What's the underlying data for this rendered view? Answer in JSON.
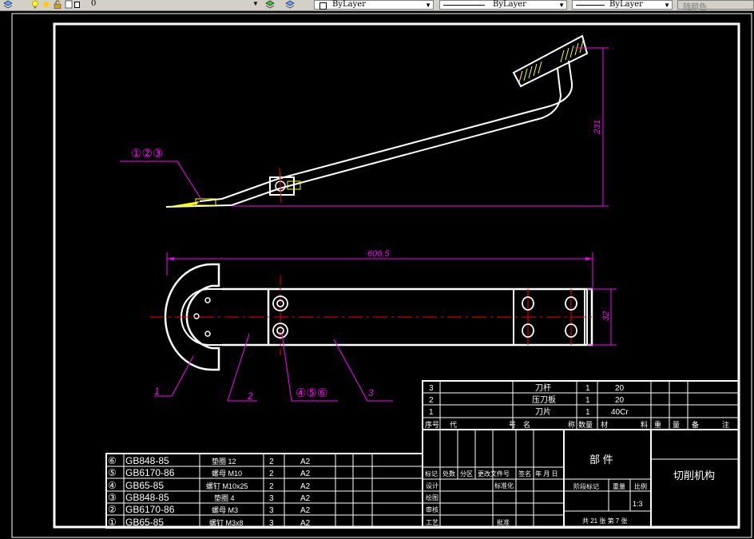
{
  "toolbar": {
    "layer_name": "0",
    "color_combo": "ByLayer",
    "linetype_combo": "ByLayer",
    "lineweight_combo": "ByLayer",
    "plotstyle_combo": "随颜色"
  },
  "drawing": {
    "callouts": {
      "top_left": "①②③",
      "bottom_456": "④⑤⑥",
      "item_1": "1",
      "item_2": "2",
      "item_3": "3"
    },
    "dims": {
      "height": "231",
      "length": "606.5",
      "width": "32"
    }
  },
  "parts_list": {
    "rows": [
      {
        "no": "3",
        "name": "刀杆",
        "qty": "1",
        "material": "20"
      },
      {
        "no": "2",
        "name": "压刀板",
        "qty": "1",
        "material": "20"
      },
      {
        "no": "1",
        "name": "刀片",
        "qty": "1",
        "material": "40Cr"
      }
    ],
    "header": {
      "no": "序号",
      "code": "代",
      "code2": "号",
      "name": "名",
      "name2": "称",
      "qty": "数量",
      "material": "材",
      "material2": "料",
      "weight": "重",
      "weight2": "量",
      "note": "备",
      "note2": "注"
    }
  },
  "std_parts": [
    {
      "no": "⑥",
      "code": "GB848-85",
      "name": "垫圈 12",
      "qty": "2",
      "mat": "A2"
    },
    {
      "no": "⑤",
      "code": "GB6170-86",
      "name": "螺母 M10",
      "qty": "2",
      "mat": "A2"
    },
    {
      "no": "④",
      "code": "GB65-85",
      "name": "螺钉 M10x25",
      "qty": "2",
      "mat": "A2"
    },
    {
      "no": "③",
      "code": "GB848-85",
      "name": "垫圈 4",
      "qty": "3",
      "mat": "A2"
    },
    {
      "no": "②",
      "code": "GB6170-86",
      "name": "螺母 M3",
      "qty": "3",
      "mat": "A2"
    },
    {
      "no": "①",
      "code": "GB65-85",
      "name": "螺钉 M3x8",
      "qty": "3",
      "mat": "A2"
    }
  ],
  "title_block": {
    "rev_row": [
      "标记",
      "处数",
      "分区",
      "更改文件号",
      "签名",
      "年 月 日"
    ],
    "design": "设计",
    "standard": "标准化",
    "drawn": "绘图",
    "check": "审核",
    "process": "工艺",
    "approve": "批准",
    "part_label": "部  件",
    "stage": "阶段标记",
    "weight": "重量",
    "scale": "比例",
    "scale_value": "1:3",
    "sheets": "共 21 张 第 7 张",
    "title": "切削机构"
  },
  "colors": {
    "outline": "#ffffff",
    "dimension": "#ff00ff",
    "centerline": "#ff0000",
    "hatch": "#ffff00",
    "background": "#000000"
  }
}
